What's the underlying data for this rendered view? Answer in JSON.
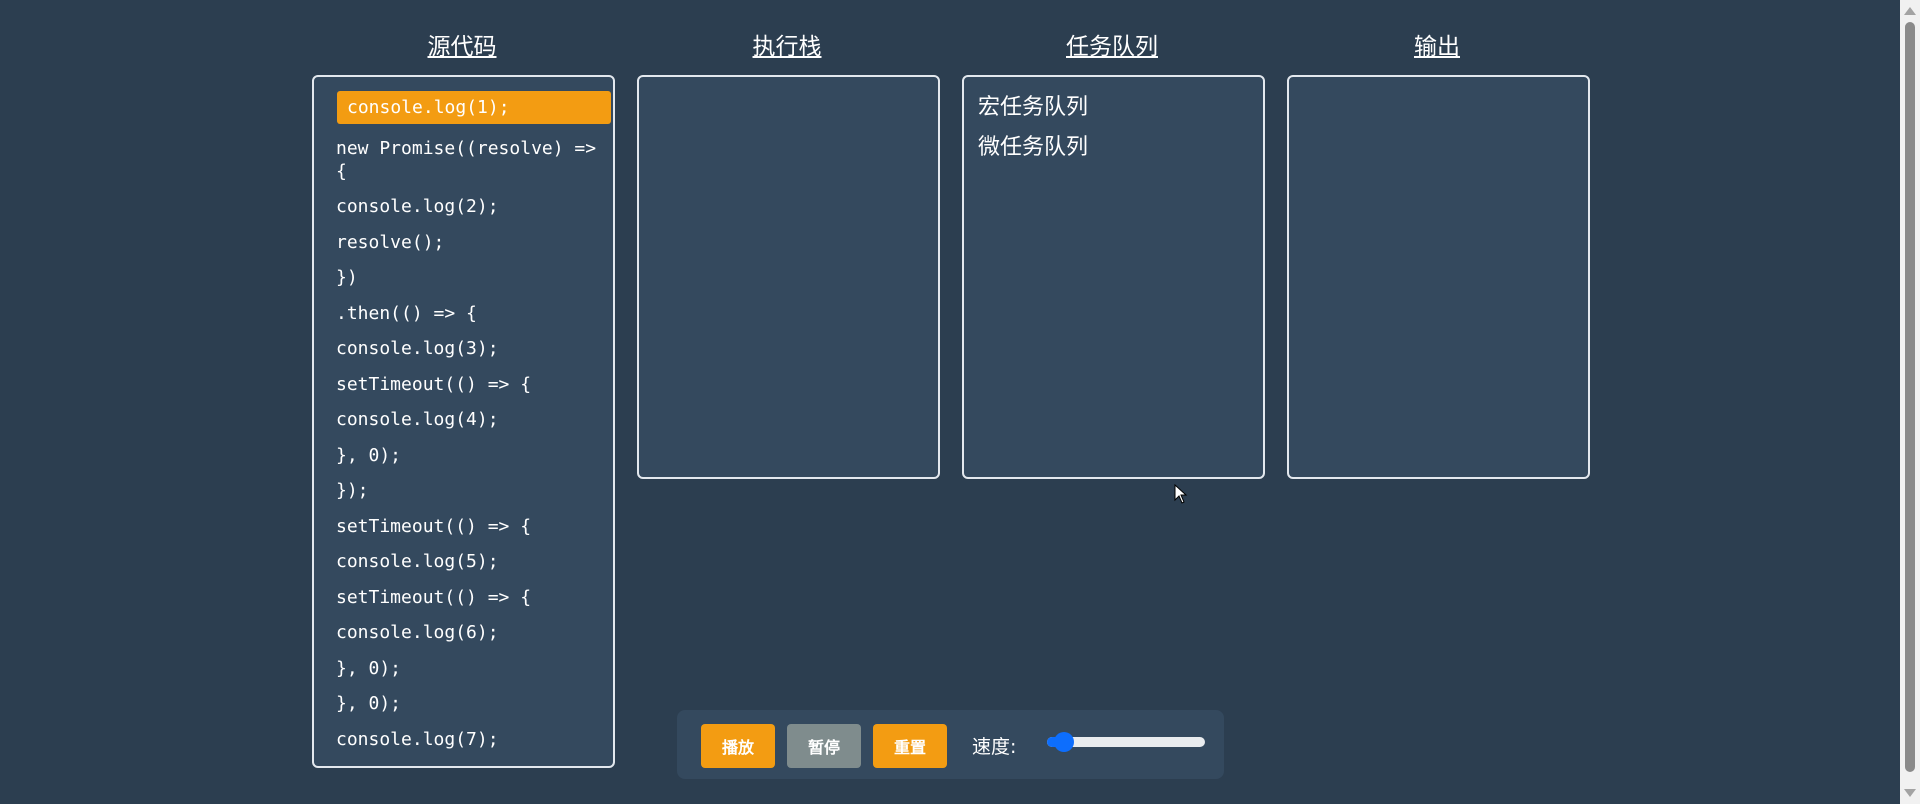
{
  "panels": {
    "source_title": "源代码",
    "stack_title": "执行栈",
    "queue_title": "任务队列",
    "output_title": "输出"
  },
  "source": {
    "active_index": 0,
    "lines": [
      "console.log(1);",
      "new Promise((resolve) => {",
      "console.log(2);",
      "resolve();",
      "})",
      ".then(() => {",
      "console.log(3);",
      "setTimeout(() => {",
      "console.log(4);",
      "}, 0);",
      "});",
      "setTimeout(() => {",
      "console.log(5);",
      "setTimeout(() => {",
      "console.log(6);",
      "}, 0);",
      "}, 0);",
      "console.log(7);"
    ]
  },
  "queue": {
    "macro_label": "宏任务队列",
    "micro_label": "微任务队列"
  },
  "controls": {
    "play_label": "播放",
    "pause_label": "暂停",
    "reset_label": "重置",
    "speed_label": "速度:",
    "speed_value": 0.05
  },
  "colors": {
    "background": "#2c3e50",
    "panel": "#34495e",
    "accent": "#f39c12",
    "pause": "#7f8c8d",
    "slider": "#0d6efd"
  },
  "icons": {
    "cursor": "mouse-pointer-icon",
    "scroll_up": "scroll-up-arrow-icon",
    "scroll_down": "scroll-down-arrow-icon"
  }
}
